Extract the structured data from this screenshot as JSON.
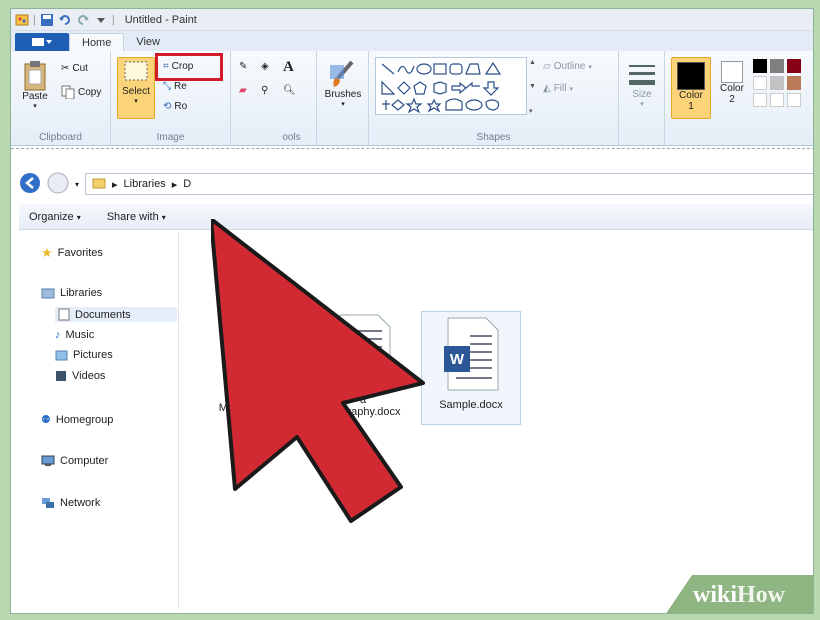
{
  "window": {
    "title": "Untitled - Paint"
  },
  "ribbon_tabs": {
    "file": "",
    "home": "Home",
    "view": "View"
  },
  "clipboard": {
    "paste": "Paste",
    "cut": "Cut",
    "copy": "Copy",
    "label": "Clipboard"
  },
  "image": {
    "select": "Select",
    "crop": "Crop",
    "resize": "Re",
    "rotate": "Ro",
    "label": "Image"
  },
  "tools": {
    "label": "ools"
  },
  "brushes": {
    "label": "Brushes"
  },
  "shapes": {
    "outline": "Outline",
    "fill": "Fill",
    "label": "Shapes"
  },
  "size": {
    "label": "Size"
  },
  "colors": {
    "color1": "Color\n1",
    "color2": "Color\n2",
    "color1_value": "#000000",
    "color2_value": "#ffffff"
  },
  "explorer": {
    "breadcrumb_libraries": "Libraries",
    "breadcrumb_next": "D",
    "organize": "Organize",
    "share_with": "Share with",
    "nav": {
      "favorites": "Favorites",
      "libraries": "Libraries",
      "documents": "Documents",
      "music": "Music",
      "pictures": "Pictures",
      "videos": "Videos",
      "homegroup": "Homegroup",
      "computer": "Computer",
      "network": "Network"
    },
    "files": {
      "mortgage": "Mortgage.xlsx",
      "biography_line1": "a",
      "biography_line2": "Biography.docx",
      "sample": "Sample.docx"
    }
  },
  "watermark": {
    "wiki": "wiki",
    "how": "How"
  },
  "accent": {
    "arrow": "#d12a33",
    "highlight": "#d31b2a"
  }
}
